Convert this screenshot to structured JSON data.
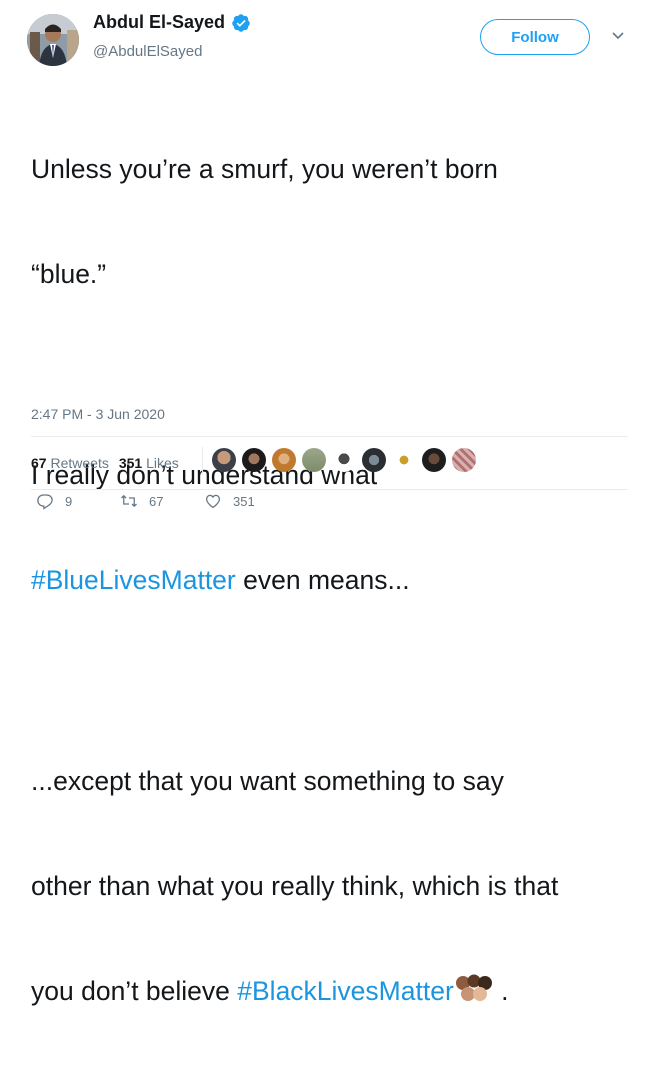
{
  "user": {
    "display_name": "Abdul El-Sayed",
    "handle": "@AbdulElSayed",
    "verified": true,
    "avatar_icon": "profile-photo"
  },
  "follow_button": {
    "label": "Follow"
  },
  "menu_icon": "chevron-down-icon",
  "tweet": {
    "line1": "Unless you’re a smurf, you weren’t born",
    "line2": "“blue.”",
    "line3": "I really don’t understand what",
    "hashtag1": "#BlueLivesMatter",
    "line4_rest": " even means...",
    "line5": "...except that you want something to say",
    "line6": "other than what you really think, which is that",
    "line7_prefix": "you don’t believe ",
    "hashtag2": "#BlackLivesMatter",
    "line7_suffix": " .",
    "emoji": "raised-fists"
  },
  "timestamp": "2:47 PM - 3 Jun 2020",
  "stats": {
    "retweets_count": "67",
    "retweets_label": "Retweets",
    "likes_count": "351",
    "likes_label": "Likes"
  },
  "actions": {
    "replies": "9",
    "retweets": "67",
    "likes": "351"
  },
  "colors": {
    "link": "#1b95e0",
    "brand": "#1da1f2",
    "muted": "#657786",
    "text": "#14171a"
  }
}
